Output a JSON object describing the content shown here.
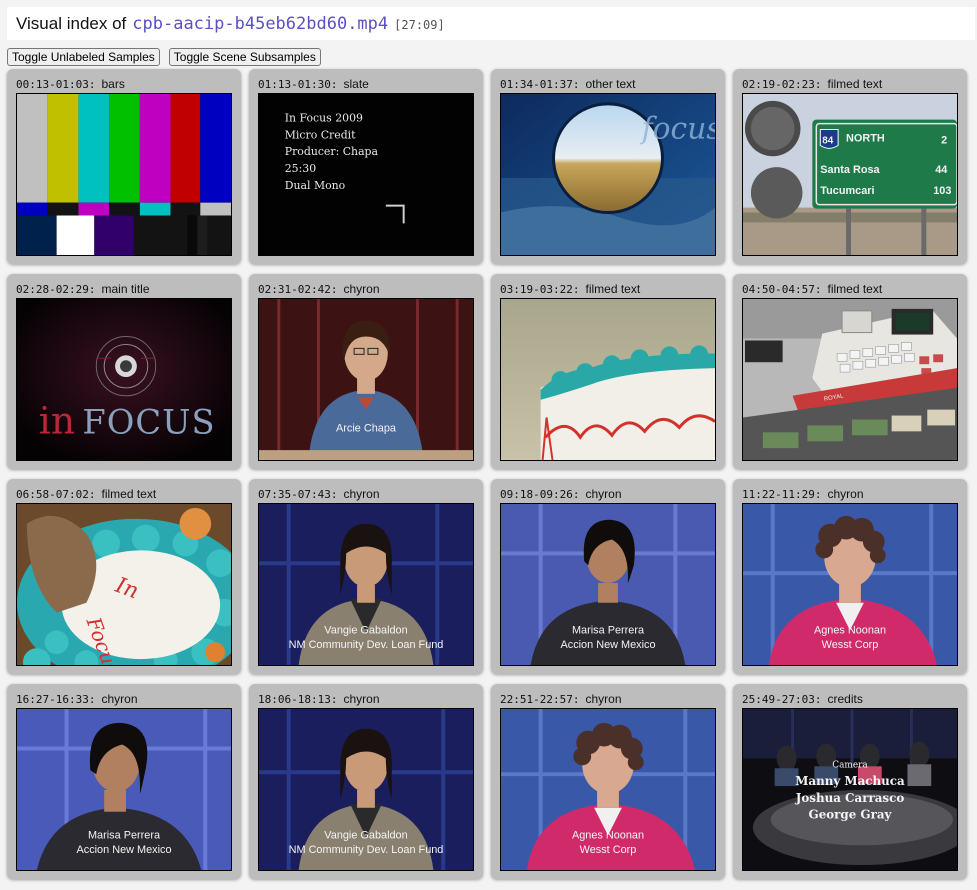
{
  "header": {
    "prefix": "Visual index of",
    "filename": "cpb-aacip-b45eb62bd60.mp4",
    "duration": "[27:09]"
  },
  "buttons": {
    "toggle_unlabeled": "Toggle Unlabeled Samples",
    "toggle_scene": "Toggle Scene Subsamples"
  },
  "samples": [
    {
      "time": "00:13-01:03:",
      "type": "bars"
    },
    {
      "time": "01:13-01:30:",
      "type": "slate",
      "text": [
        "In Focus 2009",
        "Micro Credit",
        "Producer: Chapa",
        "25:30",
        "Dual Mono"
      ]
    },
    {
      "time": "01:34-01:37:",
      "type": "other text",
      "text": [
        "focus"
      ]
    },
    {
      "time": "02:19-02:23:",
      "type": "filmed text",
      "text": [
        "84",
        "NORTH",
        "Santa Rosa",
        "Tucumcari",
        "2",
        "44",
        "103"
      ]
    },
    {
      "time": "02:28-02:29:",
      "type": "main title",
      "text": [
        "in",
        "FOCUS"
      ]
    },
    {
      "time": "02:31-02:42:",
      "type": "chyron",
      "text": [
        "Arcie Chapa"
      ]
    },
    {
      "time": "03:19-03:22:",
      "type": "filmed text"
    },
    {
      "time": "04:50-04:57:",
      "type": "filmed text",
      "text": [
        "ROYAL"
      ]
    },
    {
      "time": "06:58-07:02:",
      "type": "filmed text",
      "text": [
        "In",
        "Focus"
      ]
    },
    {
      "time": "07:35-07:43:",
      "type": "chyron",
      "text": [
        "Vangie Gabaldon",
        "NM Community Dev. Loan Fund"
      ]
    },
    {
      "time": "09:18-09:26:",
      "type": "chyron",
      "text": [
        "Marisa Perrera",
        "Accion New Mexico"
      ]
    },
    {
      "time": "11:22-11:29:",
      "type": "chyron",
      "text": [
        "Agnes Noonan",
        "Wesst Corp"
      ]
    },
    {
      "time": "16:27-16:33:",
      "type": "chyron",
      "text": [
        "Marisa Perrera",
        "Accion New Mexico"
      ]
    },
    {
      "time": "18:06-18:13:",
      "type": "chyron",
      "text": [
        "Vangie Gabaldon",
        "NM Community Dev. Loan Fund"
      ]
    },
    {
      "time": "22:51-22:57:",
      "type": "chyron",
      "text": [
        "Agnes Noonan",
        "Wesst Corp"
      ]
    },
    {
      "time": "25:49-27:03:",
      "type": "credits",
      "text": [
        "Camera",
        "Manny Machuca",
        "Joshua Carrasco",
        "George Gray"
      ]
    }
  ]
}
